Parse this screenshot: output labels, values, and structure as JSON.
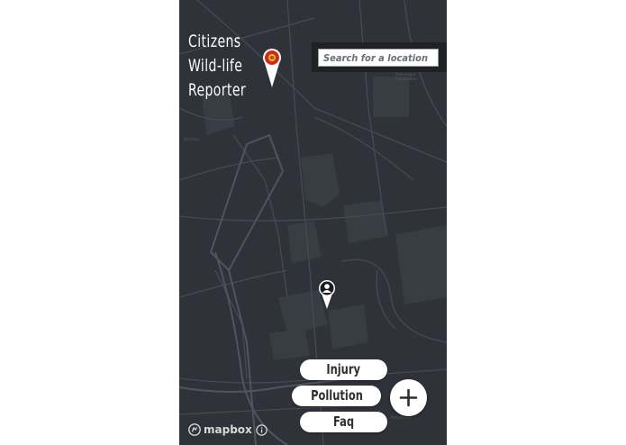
{
  "app": {
    "title_lines": [
      "Citizens",
      "Wild-life",
      "Reporter"
    ]
  },
  "search": {
    "placeholder": "Search for a location",
    "value": ""
  },
  "actions": {
    "injury_label": "Injury",
    "pollution_label": "Pollution",
    "faq_label": "Faq",
    "add_icon": "plus-icon"
  },
  "map": {
    "attribution": "mapbox",
    "info_icon": "info-icon",
    "report_marker_icon": "wildlife-report-pin-icon",
    "user_marker_icon": "user-location-pin-icon"
  },
  "colors": {
    "map_background": "#2f3238",
    "road": "#464a52",
    "building": "#383c43",
    "report_pin": "#d9261c",
    "accent_white": "#ffffff"
  }
}
